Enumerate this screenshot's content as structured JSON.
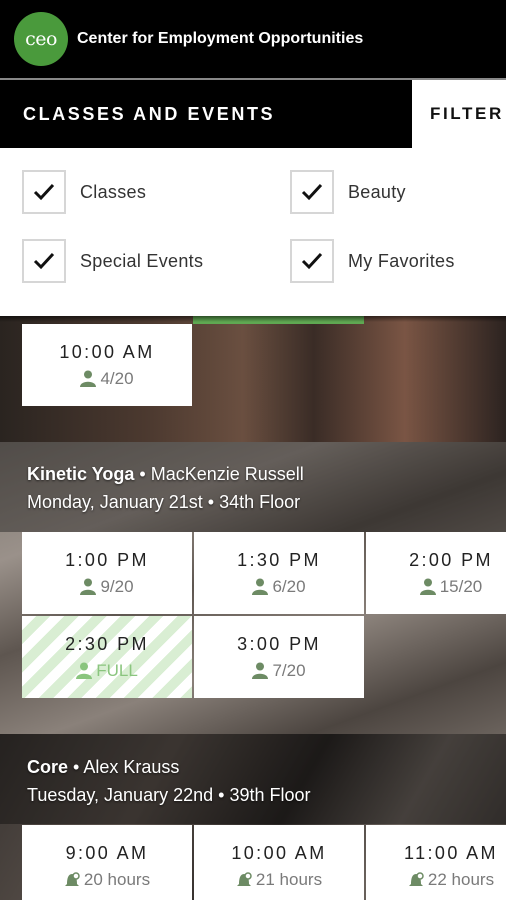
{
  "header": {
    "logo_text": "ceo",
    "org_name": "Center for Employment Opportunities"
  },
  "tabs": {
    "active": "CLASSES AND EVENTS",
    "filter": "FILTER"
  },
  "filters": [
    {
      "label": "Classes",
      "checked": true
    },
    {
      "label": "Beauty",
      "checked": true
    },
    {
      "label": "Special Events",
      "checked": true
    },
    {
      "label": "My Favorites",
      "checked": true
    }
  ],
  "previous_class": {
    "slots": [
      {
        "time": "10:00 AM",
        "spots": "4/20"
      }
    ]
  },
  "classes": [
    {
      "name": "Kinetic Yoga",
      "separator": "•",
      "instructor": "MacKenzie Russell",
      "date": "Monday, January 21st",
      "location": "34th Floor",
      "slots": [
        {
          "time": "1:00 PM",
          "spots": "9/20"
        },
        {
          "time": "1:30 PM",
          "spots": "6/20"
        },
        {
          "time": "2:00 PM",
          "spots": "15/20"
        },
        {
          "time": "2:30 PM",
          "spots": "FULL"
        },
        {
          "time": "3:00 PM",
          "spots": "7/20"
        }
      ]
    },
    {
      "name": "Core",
      "separator": "•",
      "instructor": "Alex Krauss",
      "date": "Tuesday, January 22nd",
      "location": "39th Floor",
      "slots": [
        {
          "time": "9:00 AM",
          "countdown": "20 hours"
        },
        {
          "time": "10:00 AM",
          "countdown": "21 hours"
        },
        {
          "time": "11:00 AM",
          "countdown": "22 hours"
        }
      ]
    }
  ],
  "colors": {
    "brand_green": "#4a9a3c",
    "accent_green": "#5fa852",
    "full_stripe": "#d9eed3"
  }
}
